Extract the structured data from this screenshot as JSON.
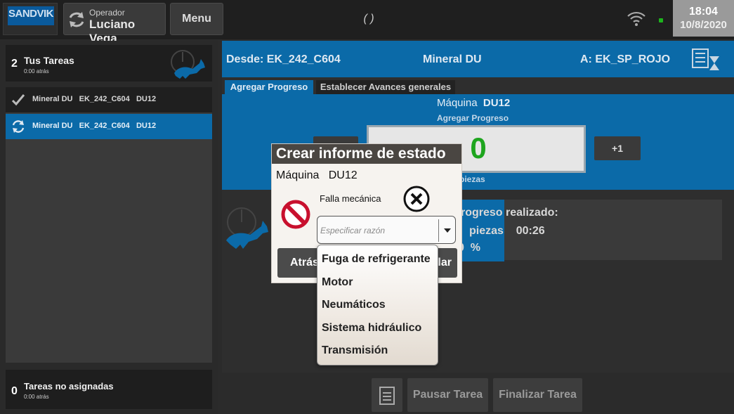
{
  "topbar": {
    "logo_text": "SANDVIK",
    "operator_label": "Operador",
    "operator_name": "Luciano Vega",
    "menu_label": "Menu",
    "center_text": "( )",
    "time": "18:04",
    "date": "10/8/2020",
    "status_color": "#1db41d"
  },
  "sidebar": {
    "my_tasks": {
      "count": "2",
      "label": "Tus Tareas",
      "ago": "0:00 atrás"
    },
    "tasks": [
      {
        "icon": "check-icon",
        "text": "Mineral DU   EK_242_C604   DU12"
      },
      {
        "icon": "refresh-icon",
        "text": "Mineral DU   EK_242_C604   DU12"
      }
    ],
    "unassigned": {
      "count": "0",
      "label": "Tareas no asignadas",
      "ago": "0:00 atrás"
    }
  },
  "route": {
    "from": "Desde:   EK_242_C604",
    "material": "Mineral DU",
    "to": "A:   EK_SP_ROJO"
  },
  "tabs": [
    {
      "label": "Agregar Progreso",
      "active": true
    },
    {
      "label": "Establecer Avances generales",
      "active": false
    }
  ],
  "progress": {
    "machine_label": "Máquina",
    "machine_id": "DU12",
    "subtitle": "Agregar Progreso",
    "counter": "0",
    "plus_label": "+1",
    "unit": "piezas"
  },
  "realizado": {
    "title": "rogreso realizado:",
    "pieces_line": "piezas    00:26",
    "pct_line": "0  %"
  },
  "bottom": {
    "pause_label": "Pausar Tarea",
    "finish_label": "Finalizar Tarea"
  },
  "modal": {
    "title": "Crear informe de estado",
    "machine_line": "Máquina   DU12",
    "fault_label": "Falla mecánica",
    "reason_placeholder": "Especificar razón",
    "back_label": "Atrás",
    "cancel_label": "lar",
    "options": [
      "Fuga de refrigerante",
      "Motor",
      "Neumáticos",
      "Sistema hidráulico",
      "Transmisión"
    ]
  },
  "colors": {
    "accent_blue": "#0b6aa8",
    "counter_green": "#1ea51e",
    "stop_red": "#c8102e"
  }
}
